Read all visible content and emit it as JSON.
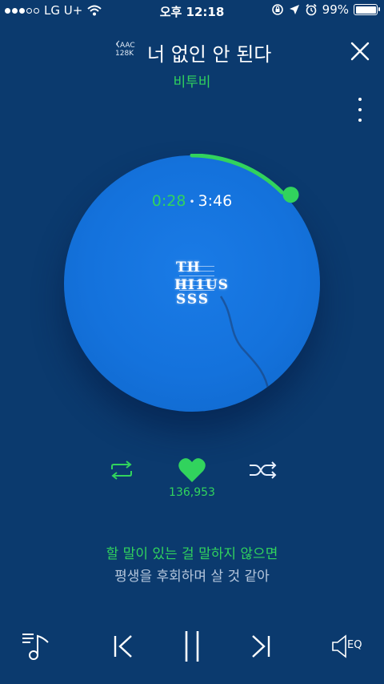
{
  "status_bar": {
    "carrier": "LG U+",
    "time": "오후 12:18",
    "battery": "99%",
    "signal_bars_on": 3,
    "signal_bars_total": 5
  },
  "header": {
    "quality_codec": "AAC",
    "quality_bitrate": "128K",
    "song_title": "너 없인 안 된다",
    "artist": "비투비"
  },
  "player": {
    "current_time": "0:28",
    "separator": "•",
    "total_time": "3:46",
    "progress_fraction": 0.124,
    "album_mark": {
      "line1": "TH",
      "line2": "HI1US",
      "line3": "SSS"
    }
  },
  "actions": {
    "like_count": "136,953"
  },
  "lyrics": {
    "current": "할 말이 있는 걸 말하지 않으면",
    "next": "평생을 후회하며 살 것 같아"
  },
  "controls": {
    "eq_label": "EQ"
  },
  "colors": {
    "background": "#0b3a6e",
    "accent_green": "#31d35d",
    "disc_blue": "#1472dc"
  }
}
